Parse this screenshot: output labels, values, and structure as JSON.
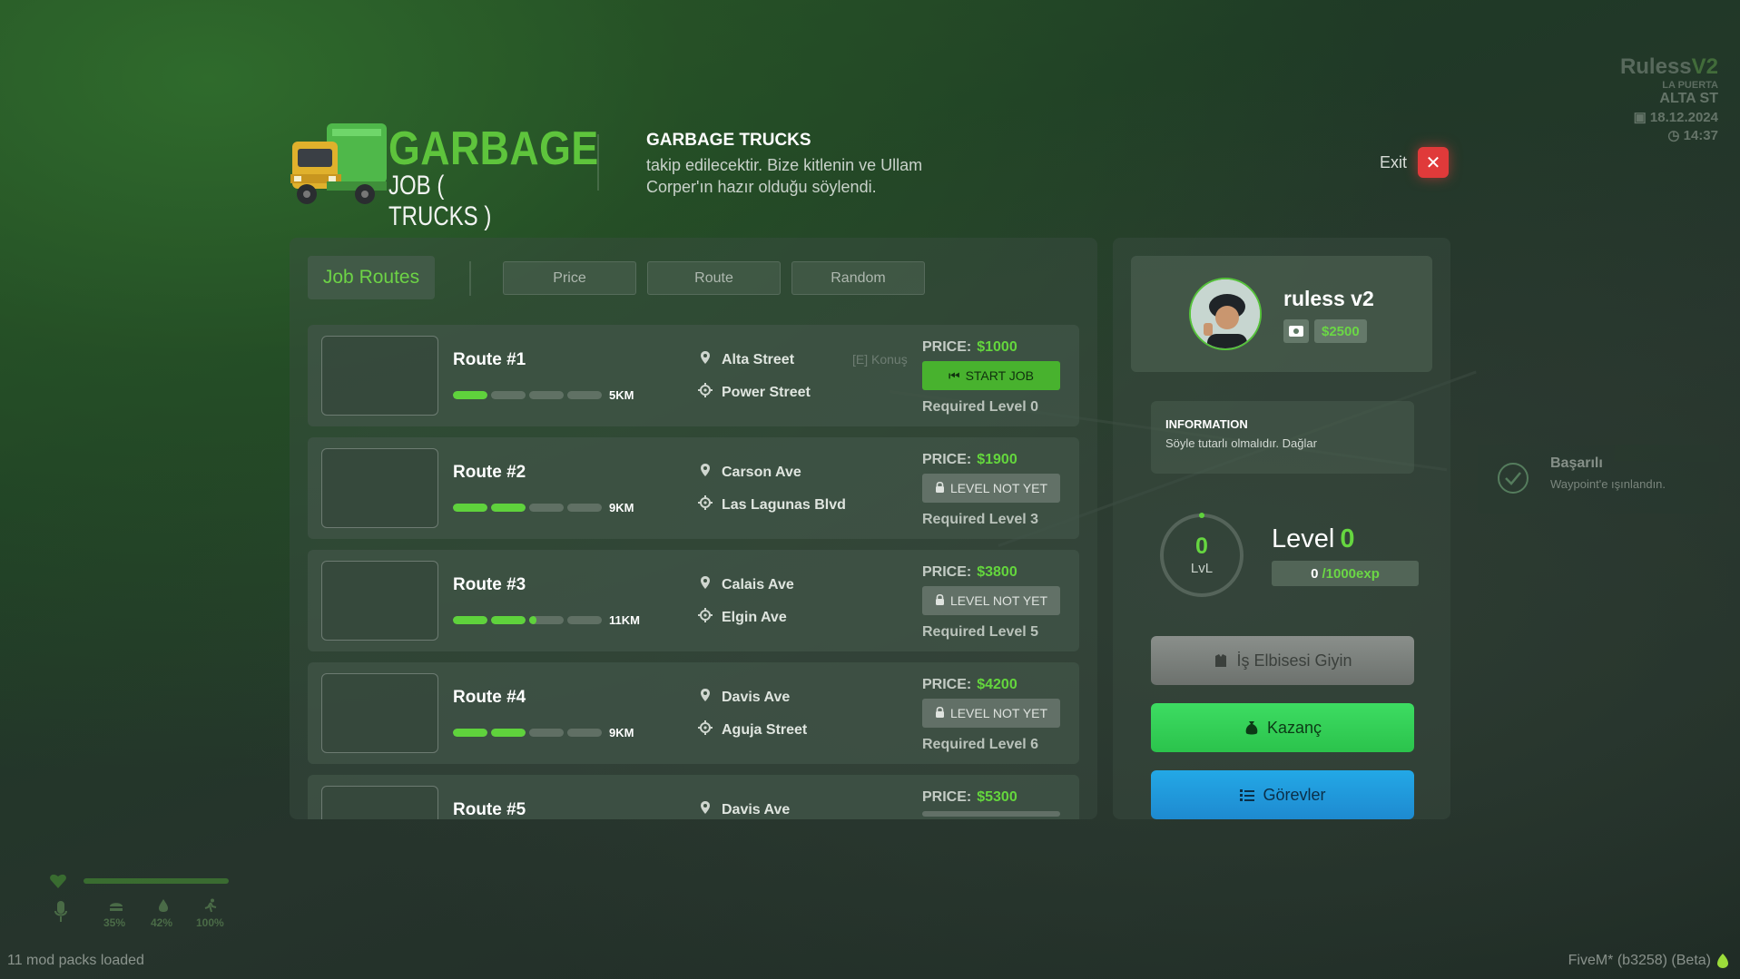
{
  "header": {
    "logo_title": "GARBAGE",
    "logo_subtitle": "JOB ( TRUCKS )",
    "title": "GARBAGE TRUCKS",
    "description": "takip edilecektir. Bize kitlenin ve Ullam Corper'ın hazır olduğu söylendi.",
    "exit_label": "Exit"
  },
  "tabs": {
    "active": "Job Routes",
    "filters": [
      "Price",
      "Route",
      "Random"
    ]
  },
  "routes": [
    {
      "name": "Route #1",
      "distance": "5KM",
      "progress": 0.25,
      "from": "Alta Street",
      "to": "Power Street",
      "price_label": "PRICE:",
      "price": "$1000",
      "button": "START JOB",
      "locked": false,
      "required": "Required Level 0"
    },
    {
      "name": "Route #2",
      "distance": "9KM",
      "progress": 0.5,
      "from": "Carson Ave",
      "to": "Las Lagunas Blvd",
      "price_label": "PRICE:",
      "price": "$1900",
      "button": "LEVEL NOT YET",
      "locked": true,
      "required": "Required Level 3"
    },
    {
      "name": "Route #3",
      "distance": "11KM",
      "progress": 0.55,
      "from": "Calais Ave",
      "to": "Elgin Ave",
      "price_label": "PRICE:",
      "price": "$3800",
      "button": "LEVEL NOT YET",
      "locked": true,
      "required": "Required Level 5"
    },
    {
      "name": "Route #4",
      "distance": "9KM",
      "progress": 0.5,
      "from": "Davis Ave",
      "to": "Aguja Street",
      "price_label": "PRICE:",
      "price": "$4200",
      "button": "LEVEL NOT YET",
      "locked": true,
      "required": "Required Level 6"
    },
    {
      "name": "Route #5",
      "distance": "",
      "progress": 0,
      "from": "Davis Ave",
      "to": "",
      "price_label": "PRICE:",
      "price": "$5300",
      "button": "",
      "locked": true,
      "required": ""
    }
  ],
  "world_prompt": "[E] Konuş",
  "profile": {
    "username": "ruless v2",
    "money": "$2500"
  },
  "information": {
    "title": "INFORMATION",
    "text": "Söyle tutarlı olmalıdır. Dağlar"
  },
  "level": {
    "circle_value": "0",
    "circle_label": "LvL",
    "title": "Level",
    "value": "0",
    "exp_current": "0",
    "exp_max": "/1000exp",
    "progress": 0
  },
  "actions": {
    "dress": "İş Elbisesi Giyin",
    "earnings": "Kazanç",
    "tasks": "Görevler"
  },
  "hud": {
    "brand_main": "Ruless",
    "brand_suffix": "V2",
    "area": "LA PUERTA",
    "street": "ALTA ST",
    "date": "18.12.2024",
    "time": "14:37",
    "stats": [
      "35%",
      "42%",
      "100%"
    ]
  },
  "notification": {
    "title": "Başarılı",
    "text": "Waypoint'e ışınlandın."
  },
  "footer": {
    "left": "11 mod packs loaded",
    "right": "FiveM* (b3258) (Beta)"
  },
  "colors": {
    "accent_green": "#5ec43c",
    "exit_red": "#e03a3a",
    "earn_green": "#3ddc62",
    "tasks_blue": "#23a8e6"
  }
}
